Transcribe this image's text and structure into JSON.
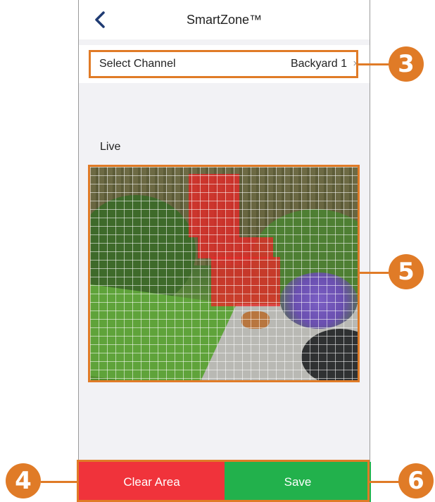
{
  "header": {
    "title": "SmartZone™",
    "back_icon": "chevron-left-icon"
  },
  "channel": {
    "label": "Select Channel",
    "value": "Backyard 1",
    "chevron": "›"
  },
  "live": {
    "label": "Live"
  },
  "actions": {
    "clear_label": "Clear Area",
    "save_label": "Save"
  },
  "callouts": {
    "c3": "3",
    "c4": "4",
    "c5": "5",
    "c6": "6"
  },
  "colors": {
    "accent": "#e07b27",
    "clear": "#f0333b",
    "save": "#22b14c",
    "zone": "#e82828"
  }
}
